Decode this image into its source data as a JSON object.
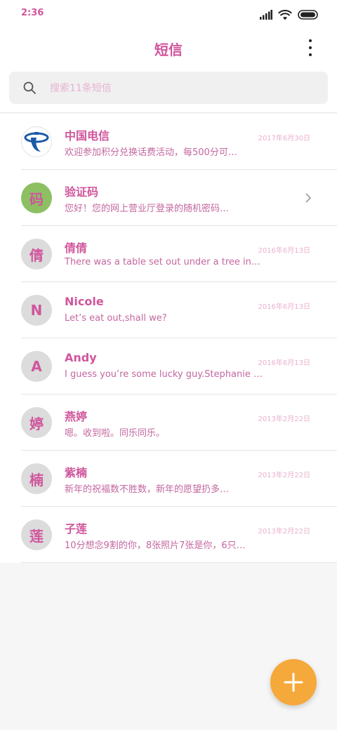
{
  "status_bar": {
    "time": "2:36",
    "icons": [
      "signal-icon",
      "wifi-icon",
      "battery-icon"
    ]
  },
  "header": {
    "title": "短信",
    "menu_icon": "more-vertical-icon"
  },
  "search": {
    "placeholder": "搜索11条短信",
    "icon": "search-icon"
  },
  "colors": {
    "accent_text": "#d0569c",
    "fab": "#f6a93b",
    "verify_avatar": "#8cc063"
  },
  "conversations": [
    {
      "name": "中国电信",
      "preview": "欢迎参加积分兑换话费活动，每500分可…",
      "date": "2017年6月30日",
      "avatar": "",
      "avatar_icon": "china-telecom-logo"
    },
    {
      "name": "验证码",
      "preview": "您好！您的网上营业厅登录的随机密码…",
      "date": "",
      "avatar": "码",
      "avatar_icon": "chevron-right-icon"
    },
    {
      "name": "倩倩",
      "preview": "There was a table set out under a tree in…",
      "date": "2016年6月13日",
      "avatar": "倩"
    },
    {
      "name": "Nicole",
      "preview": "Let’s eat out,shall we?",
      "date": "2016年6月13日",
      "avatar": "N"
    },
    {
      "name": "Andy",
      "preview": "I guess you’re some lucky guy.Stephanie …",
      "date": "2016年6月13日",
      "avatar": "A"
    },
    {
      "name": "燕婷",
      "preview": "嗯。收到啦。同乐同乐。",
      "date": "2013年2月22日",
      "avatar": "婷"
    },
    {
      "name": "紫楠",
      "preview": "新年的祝福数不胜数，新年的愿望扔多…",
      "date": "2013年2月22日",
      "avatar": "楠"
    },
    {
      "name": "子莲",
      "preview": "10分想念9割的你，8张照片7张是你，6只…",
      "date": "2013年2月22日",
      "avatar": "莲"
    }
  ],
  "fab": {
    "icon": "plus-icon"
  }
}
